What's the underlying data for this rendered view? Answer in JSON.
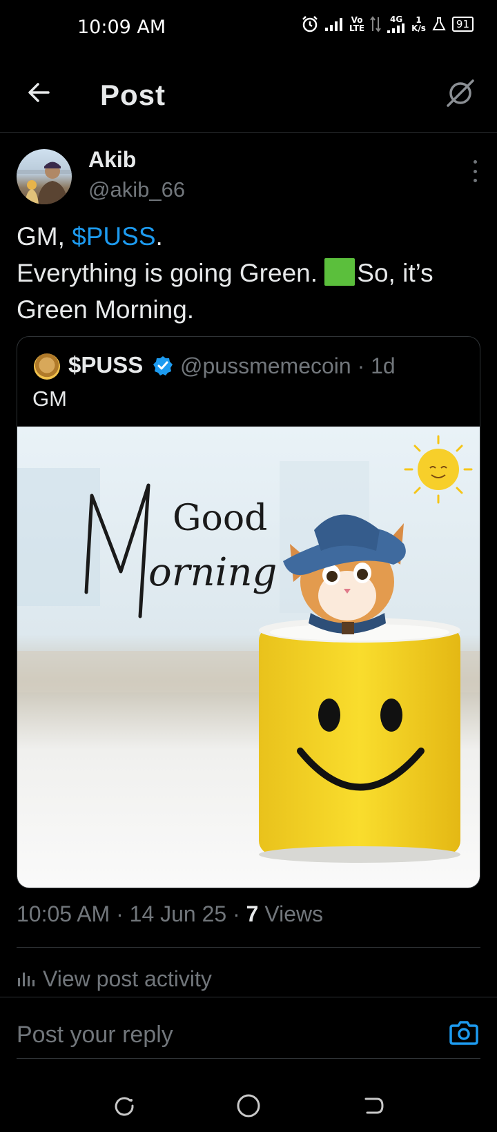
{
  "status_bar": {
    "time": "10:09 AM",
    "volte_top": "Vo",
    "volte_bottom": "LTE",
    "network": "4G",
    "speed_top": "1",
    "speed_bottom": "K/s",
    "battery": "91"
  },
  "header": {
    "title": "Post"
  },
  "post": {
    "author_name": "Akib",
    "author_handle": "@akib_66",
    "text_before_tag": "GM, ",
    "cashtag": "$PUSS",
    "text_after_tag": ".",
    "line2_before": "Everything is going Green. ",
    "line2_after": "So, it’s",
    "line3": "Green Morning."
  },
  "quote": {
    "name": "$PUSS",
    "handle_time": "@pussmemecoin · 1d",
    "text": "GM",
    "image_text_1": "Good",
    "image_text_2": "Morning"
  },
  "meta": {
    "time_date": "10:05 AM · 14 Jun 25 · ",
    "views_count": "7",
    "views_label": " Views"
  },
  "activity": {
    "label": "View post activity"
  },
  "reply": {
    "placeholder": "Post your reply"
  },
  "icons": {
    "back": "back-arrow-icon",
    "grok": "grok-icon",
    "more": "more-vertical-icon",
    "verified": "verified-badge-icon",
    "chart": "bar-chart-icon",
    "camera": "camera-icon"
  },
  "colors": {
    "accent": "#1d9bf0",
    "muted": "#71767b",
    "text": "#e7e9ea",
    "background": "#000000"
  }
}
